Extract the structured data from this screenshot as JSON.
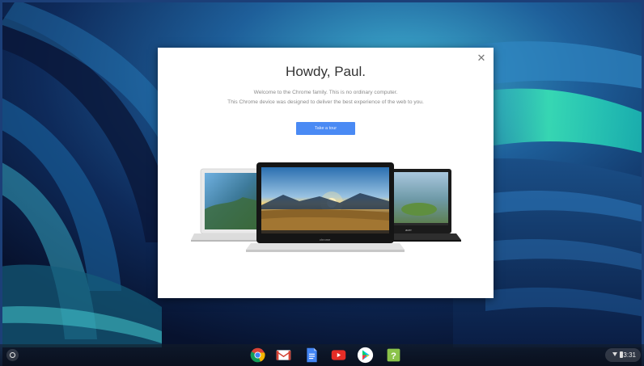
{
  "dialog": {
    "title": "Howdy, Paul.",
    "line1": "Welcome to the Chrome family. This is no ordinary computer.",
    "line2": "This Chrome device was designed to deliver the best experience of the web to you.",
    "tour_button": "Take a tour",
    "close_icon": "close-icon",
    "device_logos": {
      "center": "chrome",
      "right": "acer"
    }
  },
  "shelf": {
    "launcher_icon": "launcher-icon",
    "apps": [
      {
        "name": "chrome",
        "icon": "chrome-icon"
      },
      {
        "name": "gmail",
        "icon": "gmail-icon"
      },
      {
        "name": "docs",
        "icon": "docs-icon"
      },
      {
        "name": "youtube",
        "icon": "youtube-icon"
      },
      {
        "name": "play-store",
        "icon": "play-store-icon"
      },
      {
        "name": "get-help",
        "icon": "help-icon"
      }
    ],
    "status": {
      "time": "3:31",
      "wifi_icon": "wifi-icon",
      "battery_icon": "battery-icon"
    }
  },
  "colors": {
    "accent": "#4a8af4",
    "frame": "#1c3f78"
  }
}
